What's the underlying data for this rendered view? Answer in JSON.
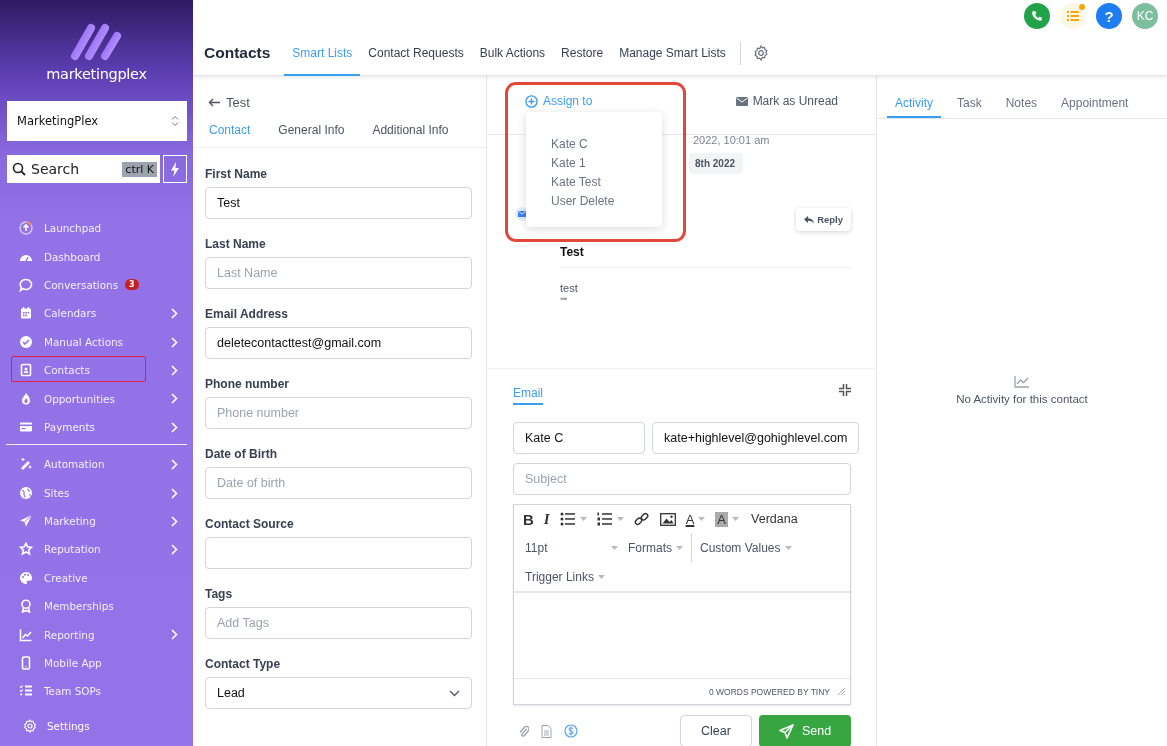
{
  "sidebar": {
    "logo_text": "marketingplex",
    "account": "MarketingPlex",
    "search": {
      "placeholder": "Search",
      "shortcut": "ctrl K"
    },
    "groups": [
      [
        {
          "label": "Launchpad",
          "has_submenu": false,
          "highlighted": false
        },
        {
          "label": "Dashboard",
          "has_submenu": false,
          "highlighted": false
        },
        {
          "label": "Conversations",
          "has_submenu": false,
          "highlighted": false,
          "badge": "3"
        },
        {
          "label": "Calendars",
          "has_submenu": true,
          "highlighted": false
        },
        {
          "label": "Manual Actions",
          "has_submenu": true,
          "highlighted": false
        },
        {
          "label": "Contacts",
          "has_submenu": true,
          "highlighted": true
        },
        {
          "label": "Opportunities",
          "has_submenu": true,
          "highlighted": false
        },
        {
          "label": "Payments",
          "has_submenu": true,
          "highlighted": false
        }
      ],
      [
        {
          "label": "Automation",
          "has_submenu": true,
          "highlighted": false
        },
        {
          "label": "Sites",
          "has_submenu": true,
          "highlighted": false
        },
        {
          "label": "Marketing",
          "has_submenu": true,
          "highlighted": false
        },
        {
          "label": "Reputation",
          "has_submenu": true,
          "highlighted": false
        },
        {
          "label": "Creative",
          "has_submenu": false,
          "highlighted": false
        },
        {
          "label": "Memberships",
          "has_submenu": false,
          "highlighted": false
        },
        {
          "label": "Reporting",
          "has_submenu": true,
          "highlighted": false
        },
        {
          "label": "Mobile App",
          "has_submenu": false,
          "highlighted": false
        },
        {
          "label": "Team SOPs",
          "has_submenu": false,
          "highlighted": false
        }
      ]
    ],
    "settings": "Settings"
  },
  "header": {
    "help": "?",
    "avatar": "KC",
    "title": "Contacts",
    "tabs": [
      {
        "label": "Smart Lists",
        "selected": true
      },
      {
        "label": "Contact Requests",
        "selected": false
      },
      {
        "label": "Bulk Actions",
        "selected": false
      },
      {
        "label": "Restore",
        "selected": false
      },
      {
        "label": "Manage Smart Lists",
        "selected": false
      }
    ]
  },
  "contact": {
    "back": "Test",
    "tabs": [
      {
        "label": "Contact",
        "selected": true
      },
      {
        "label": "General Info",
        "selected": false
      },
      {
        "label": "Additional Info",
        "selected": false
      }
    ],
    "fields": [
      {
        "label": "First Name",
        "kind": "text",
        "value": "Test"
      },
      {
        "label": "Last Name",
        "kind": "text",
        "placeholder": "Last Name"
      },
      {
        "label": "Email Address",
        "kind": "text",
        "value": "deletecontacttest@gmail.com"
      },
      {
        "label": "Phone number",
        "kind": "text",
        "placeholder": "Phone number"
      },
      {
        "label": "Date of Birth",
        "kind": "text",
        "placeholder": "Date of birth"
      },
      {
        "label": "Contact Source",
        "kind": "text"
      },
      {
        "label": "Tags",
        "kind": "text",
        "placeholder": "Add Tags"
      },
      {
        "label": "Contact Type",
        "kind": "select",
        "value": "Lead"
      }
    ]
  },
  "conversation": {
    "assign_to": "Assign to",
    "mark_unread": "Mark as Unread",
    "dropdown": {
      "highlighted": true,
      "items": [
        "Kate C",
        "Kate 1",
        "Kate Test",
        "User Delete"
      ]
    },
    "message": {
      "time": "2022, 10:01 am",
      "date": "8th 2022",
      "reply": "Reply",
      "subject": "Test",
      "body": "test",
      "more": "•••"
    },
    "composer": {
      "tab": "Email",
      "from": "Kate C",
      "to": "kate+highlevel@gohighlevel.com",
      "subject_placeholder": "Subject",
      "format_buttons": [
        {
          "kind": "bold",
          "glyph": "B"
        },
        {
          "kind": "italic",
          "glyph": "I"
        },
        {
          "kind": "bullet-list"
        },
        {
          "kind": "numbered-list"
        },
        {
          "kind": "link"
        },
        {
          "kind": "image"
        },
        {
          "kind": "text-color",
          "glyph": "A"
        },
        {
          "kind": "highlight",
          "glyph": "A"
        }
      ],
      "font": "Verdana",
      "size": "11pt",
      "menus": [
        "Formats",
        "Custom Values"
      ],
      "trigger_links": "Trigger Links",
      "status": "0 WORDS POWERED BY TINY",
      "clear": "Clear",
      "send": "Send"
    }
  },
  "activity": {
    "tabs": [
      {
        "label": "Activity",
        "selected": true
      },
      {
        "label": "Task",
        "selected": false
      },
      {
        "label": "Notes",
        "selected": false
      },
      {
        "label": "Appointment",
        "selected": false
      }
    ],
    "empty": "No Activity for this contact"
  }
}
